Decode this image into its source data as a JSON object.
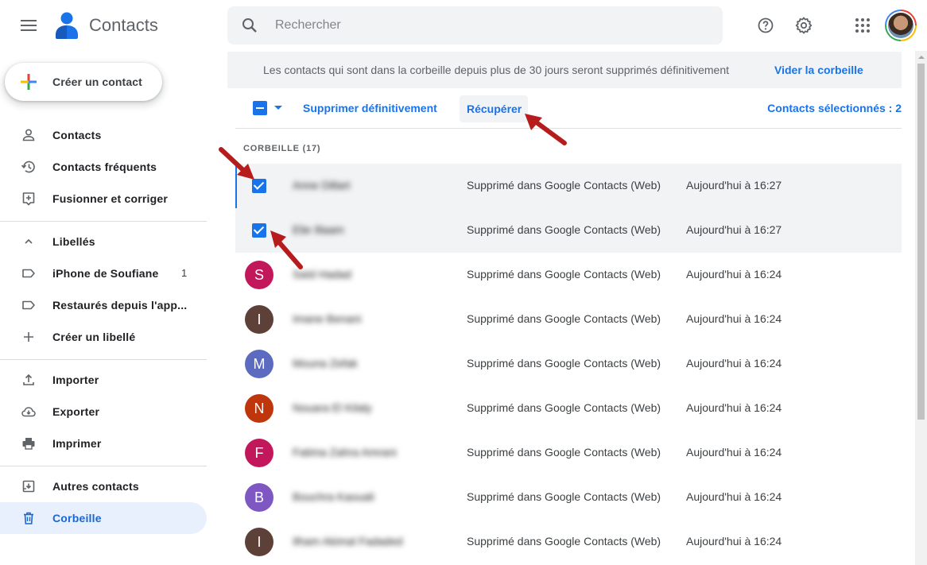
{
  "header": {
    "app_title": "Contacts",
    "search_placeholder": "Rechercher"
  },
  "sidebar": {
    "create_label": "Créer un contact",
    "items": [
      {
        "label": "Contacts",
        "icon": "person-icon"
      },
      {
        "label": "Contacts fréquents",
        "icon": "history-icon"
      },
      {
        "label": "Fusionner et corriger",
        "icon": "add-box-icon"
      },
      {
        "label": "Libellés",
        "icon": "chevron-up-icon"
      },
      {
        "label": "iPhone de Soufiane",
        "icon": "label-icon",
        "count": "1"
      },
      {
        "label": "Restaurés depuis l'app...",
        "icon": "label-icon"
      },
      {
        "label": "Créer un libellé",
        "icon": "plus-icon"
      },
      {
        "label": "Importer",
        "icon": "upload-icon"
      },
      {
        "label": "Exporter",
        "icon": "cloud-download-icon"
      },
      {
        "label": "Imprimer",
        "icon": "print-icon"
      },
      {
        "label": "Autres contacts",
        "icon": "archive-icon"
      },
      {
        "label": "Corbeille",
        "icon": "trash-icon",
        "active": true
      }
    ]
  },
  "banner": {
    "text": "Les contacts qui sont dans la corbeille depuis plus de 30 jours seront supprimés définitivement",
    "action": "Vider la corbeille"
  },
  "toolbar": {
    "delete_label": "Supprimer définitivement",
    "recover_label": "Récupérer",
    "selected_count": "Contacts sélectionnés : 2"
  },
  "list": {
    "section_title": "CORBEILLE (17)",
    "rows": [
      {
        "selected": true,
        "initial": "",
        "color": "",
        "name": "Anne Dillart",
        "desc": "Supprimé dans Google Contacts (Web)",
        "date": "Aujourd'hui à 16:27"
      },
      {
        "selected": true,
        "initial": "",
        "color": "",
        "name": "Elie Illaam",
        "desc": "Supprimé dans Google Contacts (Web)",
        "date": "Aujourd'hui à 16:27"
      },
      {
        "selected": false,
        "initial": "S",
        "color": "#c2185b",
        "name": "Saïd Hadad",
        "desc": "Supprimé dans Google Contacts (Web)",
        "date": "Aujourd'hui à 16:24"
      },
      {
        "selected": false,
        "initial": "I",
        "color": "#5d4037",
        "name": "Imane Benani",
        "desc": "Supprimé dans Google Contacts (Web)",
        "date": "Aujourd'hui à 16:24"
      },
      {
        "selected": false,
        "initial": "M",
        "color": "#5c6bc0",
        "name": "Mouna Zefak",
        "desc": "Supprimé dans Google Contacts (Web)",
        "date": "Aujourd'hui à 16:24"
      },
      {
        "selected": false,
        "initial": "N",
        "color": "#bf360c",
        "name": "Nouara El Kilaly",
        "desc": "Supprimé dans Google Contacts (Web)",
        "date": "Aujourd'hui à 16:24"
      },
      {
        "selected": false,
        "initial": "F",
        "color": "#c2185b",
        "name": "Fatima Zahra Amrani",
        "desc": "Supprimé dans Google Contacts (Web)",
        "date": "Aujourd'hui à 16:24"
      },
      {
        "selected": false,
        "initial": "B",
        "color": "#7e57c2",
        "name": "Bouchra Kaouali",
        "desc": "Supprimé dans Google Contacts (Web)",
        "date": "Aujourd'hui à 16:24"
      },
      {
        "selected": false,
        "initial": "I",
        "color": "#5d4037",
        "name": "Ilham Akimal Fadaded",
        "desc": "Supprimé dans Google Contacts (Web)",
        "date": "Aujourd'hui à 16:24"
      }
    ]
  }
}
